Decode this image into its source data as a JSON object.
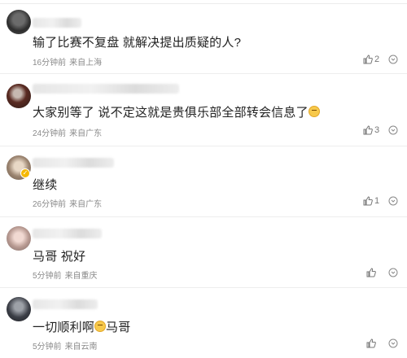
{
  "comments": [
    {
      "text": "输了比赛不复盘 就解决提出质疑的人?",
      "time": "16分钟前",
      "location": "来自上海",
      "likes": "2",
      "avatar_icon": "user-avatar-icon",
      "has_emoji": false
    },
    {
      "text": "大家别等了 说不定这就是贵俱乐部全部转会信息了",
      "time": "24分钟前",
      "location": "来自广东",
      "likes": "3",
      "avatar_icon": "user-avatar-icon",
      "emoji_icon": "thinking-emoji-icon",
      "has_emoji": true
    },
    {
      "text": "继续",
      "time": "26分钟前",
      "location": "来自广东",
      "likes": "1",
      "avatar_icon": "user-avatar-icon",
      "verified": true
    },
    {
      "text": "马哥 祝好",
      "time": "5分钟前",
      "location": "来自重庆",
      "likes": "",
      "avatar_icon": "user-avatar-icon"
    },
    {
      "text_before": "一切顺利啊",
      "text_after": "马哥",
      "time": "5分钟前",
      "location": "来自云南",
      "likes": "",
      "avatar_icon": "user-avatar-icon",
      "emoji_icon": "crying-emoji-icon"
    }
  ],
  "icons": {
    "like": "thumbs-up-icon",
    "more": "more-options-icon"
  }
}
